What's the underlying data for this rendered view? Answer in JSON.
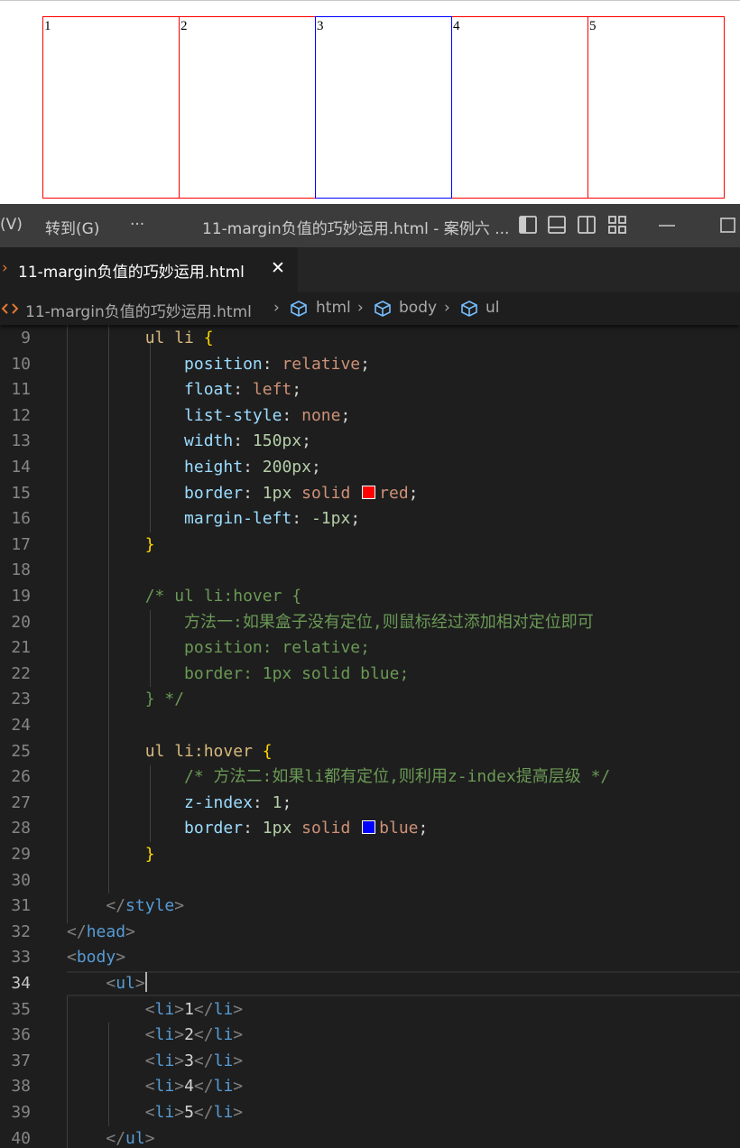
{
  "preview": {
    "boxes": [
      {
        "label": "1",
        "hover": false
      },
      {
        "label": "2",
        "hover": false
      },
      {
        "label": "3",
        "hover": true
      },
      {
        "label": "4",
        "hover": false
      },
      {
        "label": "5",
        "hover": false
      }
    ],
    "colors": {
      "border": "#ff0000",
      "hover_border": "#0000ff"
    }
  },
  "titlebar": {
    "menu_view": "(V)",
    "menu_goto": "转到(G)",
    "menu_more": "···",
    "title": "11-margin负值的巧妙运用.html - 案例六 ..."
  },
  "tab": {
    "label": "11-margin负值的巧妙运用.html",
    "close": "✕"
  },
  "breadcrumb": {
    "file": "11-margin负值的巧妙运用.html",
    "items": [
      "html",
      "body",
      "ul"
    ]
  },
  "editor": {
    "active_line": "34",
    "lines": [
      {
        "n": "9",
        "tokens": [
          {
            "t": "        "
          },
          {
            "t": "ul li",
            "c": "t-sel"
          },
          {
            "t": " "
          },
          {
            "t": "{",
            "c": "t-brace"
          }
        ]
      },
      {
        "n": "10",
        "tokens": [
          {
            "t": "            "
          },
          {
            "t": "position",
            "c": "t-prop"
          },
          {
            "t": ": "
          },
          {
            "t": "relative",
            "c": "t-val"
          },
          {
            "t": ";"
          }
        ]
      },
      {
        "n": "11",
        "tokens": [
          {
            "t": "            "
          },
          {
            "t": "float",
            "c": "t-prop"
          },
          {
            "t": ": "
          },
          {
            "t": "left",
            "c": "t-val"
          },
          {
            "t": ";"
          }
        ]
      },
      {
        "n": "12",
        "tokens": [
          {
            "t": "            "
          },
          {
            "t": "list-style",
            "c": "t-prop"
          },
          {
            "t": ": "
          },
          {
            "t": "none",
            "c": "t-val"
          },
          {
            "t": ";"
          }
        ]
      },
      {
        "n": "13",
        "tokens": [
          {
            "t": "            "
          },
          {
            "t": "width",
            "c": "t-prop"
          },
          {
            "t": ": "
          },
          {
            "t": "150px",
            "c": "t-num"
          },
          {
            "t": ";"
          }
        ]
      },
      {
        "n": "14",
        "tokens": [
          {
            "t": "            "
          },
          {
            "t": "height",
            "c": "t-prop"
          },
          {
            "t": ": "
          },
          {
            "t": "200px",
            "c": "t-num"
          },
          {
            "t": ";"
          }
        ]
      },
      {
        "n": "15",
        "tokens": [
          {
            "t": "            "
          },
          {
            "t": "border",
            "c": "t-prop"
          },
          {
            "t": ": "
          },
          {
            "t": "1px",
            "c": "t-num"
          },
          {
            "t": " "
          },
          {
            "t": "solid",
            "c": "t-val"
          },
          {
            "t": " "
          },
          {
            "swatch": "#ff0000"
          },
          {
            "t": "red",
            "c": "t-val"
          },
          {
            "t": ";"
          }
        ]
      },
      {
        "n": "16",
        "tokens": [
          {
            "t": "            "
          },
          {
            "t": "margin-left",
            "c": "t-prop"
          },
          {
            "t": ": "
          },
          {
            "t": "-1px",
            "c": "t-num"
          },
          {
            "t": ";"
          }
        ]
      },
      {
        "n": "17",
        "tokens": [
          {
            "t": "        "
          },
          {
            "t": "}",
            "c": "t-brace"
          }
        ]
      },
      {
        "n": "18",
        "tokens": []
      },
      {
        "n": "19",
        "tokens": [
          {
            "t": "        "
          },
          {
            "t": "/* ul li:hover {",
            "c": "t-cmt"
          }
        ]
      },
      {
        "n": "20",
        "tokens": [
          {
            "t": "            "
          },
          {
            "t": "方法一:如果盒子没有定位,则鼠标经过添加相对定位即可",
            "c": "t-cmt"
          }
        ]
      },
      {
        "n": "21",
        "tokens": [
          {
            "t": "            "
          },
          {
            "t": "position: relative;",
            "c": "t-cmt"
          }
        ]
      },
      {
        "n": "22",
        "tokens": [
          {
            "t": "            "
          },
          {
            "t": "border: 1px solid blue;",
            "c": "t-cmt"
          }
        ]
      },
      {
        "n": "23",
        "tokens": [
          {
            "t": "        "
          },
          {
            "t": "} */",
            "c": "t-cmt"
          }
        ]
      },
      {
        "n": "24",
        "tokens": []
      },
      {
        "n": "25",
        "tokens": [
          {
            "t": "        "
          },
          {
            "t": "ul li:hover",
            "c": "t-sel"
          },
          {
            "t": " "
          },
          {
            "t": "{",
            "c": "t-brace"
          }
        ]
      },
      {
        "n": "26",
        "tokens": [
          {
            "t": "            "
          },
          {
            "t": "/* 方法二:如果li都有定位,则利用z-index提高层级 */",
            "c": "t-cmt"
          }
        ]
      },
      {
        "n": "27",
        "tokens": [
          {
            "t": "            "
          },
          {
            "t": "z-index",
            "c": "t-prop"
          },
          {
            "t": ": "
          },
          {
            "t": "1",
            "c": "t-num"
          },
          {
            "t": ";"
          }
        ]
      },
      {
        "n": "28",
        "tokens": [
          {
            "t": "            "
          },
          {
            "t": "border",
            "c": "t-prop"
          },
          {
            "t": ": "
          },
          {
            "t": "1px",
            "c": "t-num"
          },
          {
            "t": " "
          },
          {
            "t": "solid",
            "c": "t-val"
          },
          {
            "t": " "
          },
          {
            "swatch": "#0000ff"
          },
          {
            "t": "blue",
            "c": "t-val"
          },
          {
            "t": ";"
          }
        ]
      },
      {
        "n": "29",
        "tokens": [
          {
            "t": "        "
          },
          {
            "t": "}",
            "c": "t-brace"
          }
        ]
      },
      {
        "n": "30",
        "tokens": []
      },
      {
        "n": "31",
        "tokens": [
          {
            "t": "    "
          },
          {
            "t": "</",
            "c": "t-punc"
          },
          {
            "t": "style",
            "c": "t-tag"
          },
          {
            "t": ">",
            "c": "t-punc"
          }
        ]
      },
      {
        "n": "32",
        "tokens": [
          {
            "t": "</",
            "c": "t-punc"
          },
          {
            "t": "head",
            "c": "t-tag"
          },
          {
            "t": ">",
            "c": "t-punc"
          }
        ]
      },
      {
        "n": "33",
        "tokens": [
          {
            "t": "<",
            "c": "t-punc"
          },
          {
            "t": "body",
            "c": "t-tag"
          },
          {
            "t": ">",
            "c": "t-punc"
          }
        ]
      },
      {
        "n": "34",
        "tokens": [
          {
            "t": "    "
          },
          {
            "t": "<",
            "c": "t-punc"
          },
          {
            "t": "ul",
            "c": "t-tag"
          },
          {
            "t": ">",
            "c": "t-punc"
          },
          {
            "caret": true
          }
        ]
      },
      {
        "n": "35",
        "tokens": [
          {
            "t": "        "
          },
          {
            "t": "<",
            "c": "t-punc"
          },
          {
            "t": "li",
            "c": "t-tag"
          },
          {
            "t": ">",
            "c": "t-punc"
          },
          {
            "t": "1"
          },
          {
            "t": "</",
            "c": "t-punc"
          },
          {
            "t": "li",
            "c": "t-tag"
          },
          {
            "t": ">",
            "c": "t-punc"
          }
        ]
      },
      {
        "n": "36",
        "tokens": [
          {
            "t": "        "
          },
          {
            "t": "<",
            "c": "t-punc"
          },
          {
            "t": "li",
            "c": "t-tag"
          },
          {
            "t": ">",
            "c": "t-punc"
          },
          {
            "t": "2"
          },
          {
            "t": "</",
            "c": "t-punc"
          },
          {
            "t": "li",
            "c": "t-tag"
          },
          {
            "t": ">",
            "c": "t-punc"
          }
        ]
      },
      {
        "n": "37",
        "tokens": [
          {
            "t": "        "
          },
          {
            "t": "<",
            "c": "t-punc"
          },
          {
            "t": "li",
            "c": "t-tag"
          },
          {
            "t": ">",
            "c": "t-punc"
          },
          {
            "t": "3"
          },
          {
            "t": "</",
            "c": "t-punc"
          },
          {
            "t": "li",
            "c": "t-tag"
          },
          {
            "t": ">",
            "c": "t-punc"
          }
        ]
      },
      {
        "n": "38",
        "tokens": [
          {
            "t": "        "
          },
          {
            "t": "<",
            "c": "t-punc"
          },
          {
            "t": "li",
            "c": "t-tag"
          },
          {
            "t": ">",
            "c": "t-punc"
          },
          {
            "t": "4"
          },
          {
            "t": "</",
            "c": "t-punc"
          },
          {
            "t": "li",
            "c": "t-tag"
          },
          {
            "t": ">",
            "c": "t-punc"
          }
        ]
      },
      {
        "n": "39",
        "tokens": [
          {
            "t": "        "
          },
          {
            "t": "<",
            "c": "t-punc"
          },
          {
            "t": "li",
            "c": "t-tag"
          },
          {
            "t": ">",
            "c": "t-punc"
          },
          {
            "t": "5"
          },
          {
            "t": "</",
            "c": "t-punc"
          },
          {
            "t": "li",
            "c": "t-tag"
          },
          {
            "t": ">",
            "c": "t-punc"
          }
        ]
      },
      {
        "n": "40",
        "tokens": [
          {
            "t": "    "
          },
          {
            "t": "</",
            "c": "t-punc"
          },
          {
            "t": "ul",
            "c": "t-tag"
          },
          {
            "t": ">",
            "c": "t-punc"
          }
        ]
      }
    ]
  }
}
